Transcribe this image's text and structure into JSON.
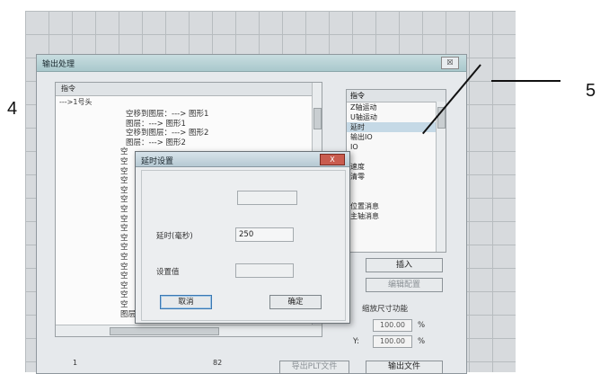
{
  "annotations": {
    "left_num": "4",
    "right_num": "5"
  },
  "window": {
    "title": "输出处理",
    "close": "☒"
  },
  "left_panel": {
    "header": "指令",
    "first": "--->1号头",
    "lines": [
      "空移到图层：---> 图形1",
      "图层：---> 图形1",
      "空移到图层：---> 图形2",
      "图层：---> 图形2",
      "空",
      "空",
      "空",
      "空",
      "空",
      "空",
      "空",
      "空",
      "空",
      "空",
      "空",
      "空",
      "空",
      "空",
      "空",
      "空",
      "空",
      "图层：---> 图形10"
    ],
    "row_number": "1",
    "total": "82"
  },
  "right_panel": {
    "header": "指令",
    "items": [
      "Z轴运动",
      "U轴运动",
      "延时",
      "输出IO",
      "IO",
      "",
      "速度",
      "清零",
      "",
      "",
      "位置消息",
      "主轴消息"
    ],
    "selected_index": 2,
    "insert_label": "插入",
    "edit_label": "编辑配置",
    "scale_label": "缩放尺寸功能",
    "x_value": "100.00",
    "y_label": "Y:",
    "y_value": "100.00",
    "pct": "%",
    "export_plt": "导出PLT文件",
    "export_file": "输出文件"
  },
  "dialog": {
    "title": "延时设置",
    "close": "X",
    "delay_label": "延时(毫秒)",
    "delay_value": "250",
    "setting_label": "设置值",
    "cancel_label": "取消",
    "ok_label": "确定"
  }
}
